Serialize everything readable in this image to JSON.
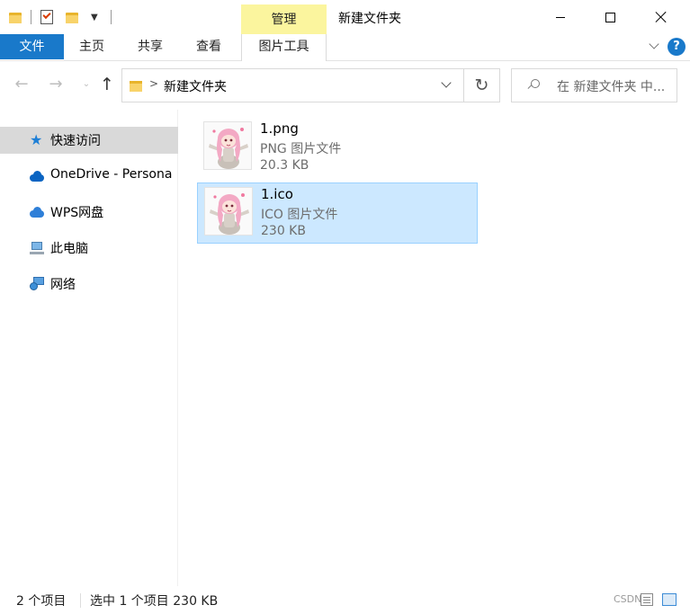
{
  "window": {
    "title": "新建文件夹",
    "contextual_tab": "管理"
  },
  "ribbon": {
    "tabs": {
      "file": "文件",
      "home": "主页",
      "share": "共享",
      "view": "查看",
      "picture_tools": "图片工具"
    },
    "help": "?"
  },
  "address_bar": {
    "path": "新建文件夹",
    "search_placeholder": "在 新建文件夹 中..."
  },
  "navigation": {
    "items": [
      {
        "label": "快速访问",
        "icon": "star-icon",
        "selected": true
      },
      {
        "label": "OneDrive - Persona",
        "icon": "onedrive-cloud-icon"
      },
      {
        "label": "WPS网盘",
        "icon": "wps-cloud-icon"
      },
      {
        "label": "此电脑",
        "icon": "computer-icon"
      },
      {
        "label": "网络",
        "icon": "network-icon"
      }
    ]
  },
  "files": [
    {
      "name": "1.png",
      "type": "PNG 图片文件",
      "size": "20.3 KB",
      "selected": false
    },
    {
      "name": "1.ico",
      "type": "ICO 图片文件",
      "size": "230 KB",
      "selected": true
    }
  ],
  "status": {
    "item_count": "2 个项目",
    "selection": "选中 1 个项目  230 KB",
    "watermark": "CSDN"
  },
  "colors": {
    "accent": "#1979ca",
    "manage_tab": "#fbf59e",
    "selection_bg": "#cce8ff",
    "selection_border": "#99d1ff"
  }
}
